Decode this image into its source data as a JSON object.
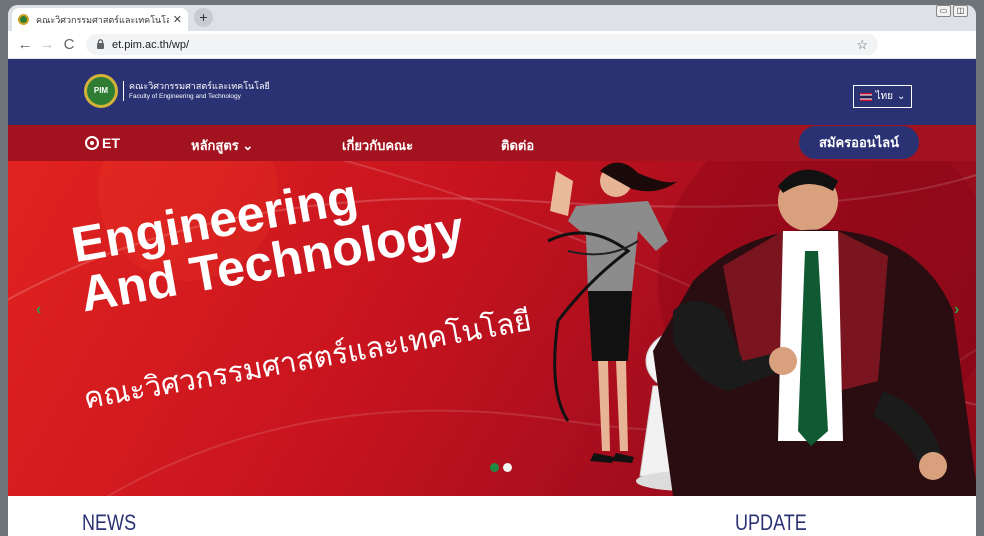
{
  "browser": {
    "tab_title": "คณะวิศวกรรมศาสตร์และเทคโนโลยี – C",
    "tab_close": "✕",
    "new_tab": "+",
    "url": "et.pim.ac.th/wp/",
    "back": "←",
    "forward": "→",
    "reload": "C",
    "star": "☆"
  },
  "header": {
    "logo_badge": "PIM",
    "logo_th": "คณะวิศวกรรมศาสตร์และเทคโนโลยี",
    "logo_en": "Faculty of Engineering and Technology",
    "language": "ไทย"
  },
  "nav": {
    "brand": "ET",
    "items": [
      {
        "label": "หลักสูตร ⌄"
      },
      {
        "label": "เกี่ยวกับคณะ"
      },
      {
        "label": "ติดต่อ"
      }
    ],
    "apply": "สมัครออนไลน์"
  },
  "hero": {
    "line1": "Engineering",
    "line2": "And Technology",
    "thai": "คณะวิศวกรรมศาสตร์และเทคโนโลยี",
    "prev": "‹",
    "next": "›",
    "slides": [
      {
        "active": true,
        "color": "#1e8a43"
      },
      {
        "active": false,
        "color": "#f2f2f2"
      }
    ]
  },
  "sections": {
    "news": "NEWS",
    "update": "UPDATE"
  },
  "colors": {
    "brand_blue": "#2b3274",
    "brand_red": "#a3131f"
  }
}
